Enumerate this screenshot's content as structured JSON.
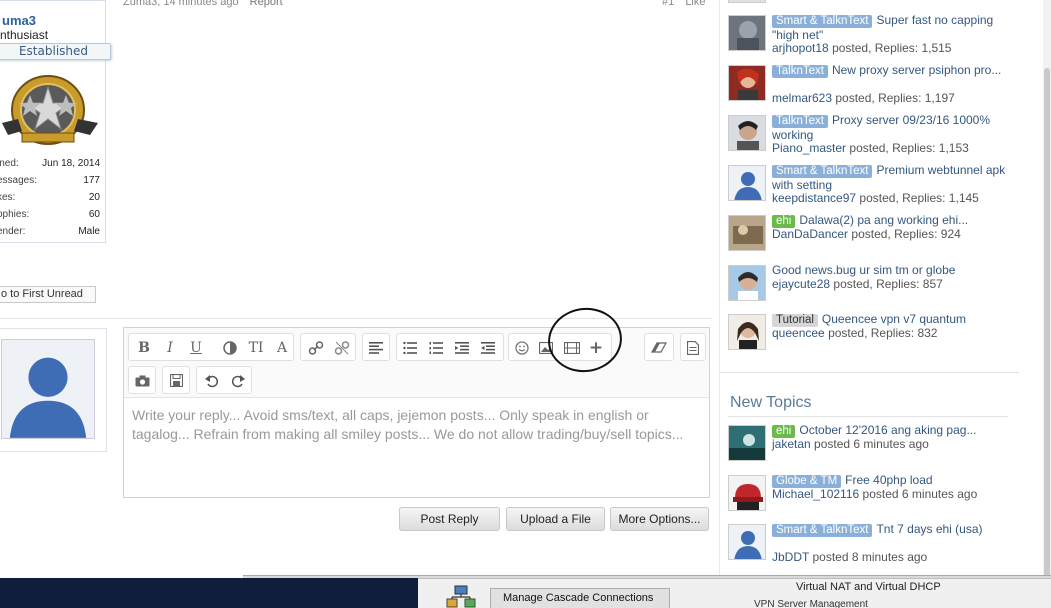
{
  "post": {
    "author": "Zuma3",
    "time": "Zuma3, 14 minutes ago",
    "report": "Report",
    "number": "#1",
    "like": "Like"
  },
  "user_card": {
    "name": "uma3",
    "title": "nthusiast",
    "banner": "Established",
    "stats": [
      {
        "key": "ined:",
        "value": "Jun 18, 2014"
      },
      {
        "key": "essages:",
        "value": "177"
      },
      {
        "key": "kes:",
        "value": "20"
      },
      {
        "key": "ophies:",
        "value": "60"
      },
      {
        "key": "ender:",
        "value": "Male"
      }
    ],
    "first_unread": "o to First Unread"
  },
  "editor": {
    "placeholder": "Write your reply... Avoid sms/text, all caps, jejemon posts... Only speak in english or tagalog... Refrain from making all smiley posts... We do not allow trading/buy/sell topics...",
    "toolbar": {
      "bold": "B",
      "italic": "I",
      "underline": "U",
      "text_size": "TI",
      "font": "A"
    }
  },
  "buttons": {
    "post_reply": "Post Reply",
    "upload_file": "Upload a File",
    "more_options": "More Options..."
  },
  "sidebar": {
    "threads": [
      {
        "prefix": "Smart & TalknText",
        "prefix_kind": "blue",
        "title": "Super fast no capping \"high net\"",
        "poster": "arjhopot18",
        "meta": "posted, Replies: 1,515"
      },
      {
        "prefix": "TalknText",
        "prefix_kind": "blue",
        "title": "New proxy server psiphon pro...",
        "poster": "melmar623",
        "meta": "posted, Replies: 1,197"
      },
      {
        "prefix": "TalknText",
        "prefix_kind": "blue",
        "title": "Proxy server 09/23/16 1000% working",
        "poster": "Piano_master",
        "meta": "posted, Replies: 1,153"
      },
      {
        "prefix": "Smart & TalknText",
        "prefix_kind": "blue",
        "title": "Premium webtunnel apk with setting",
        "poster": "keepdistance97",
        "meta": "posted, Replies: 1,145"
      },
      {
        "prefix": "ehi",
        "prefix_kind": "green",
        "title": "Dalawa(2) pa ang working ehi...",
        "poster": "DanDaDancer",
        "meta": "posted, Replies: 924"
      },
      {
        "prefix": "",
        "prefix_kind": "none",
        "title": "Good news.bug ur sim tm or globe",
        "poster": "ejaycute28",
        "meta": "posted, Replies: 857"
      },
      {
        "prefix": "Tutorial",
        "prefix_kind": "gray",
        "title": "Queencee vpn v7 quantum",
        "poster": "queencee",
        "meta": "posted, Replies: 832"
      }
    ],
    "new_topics_heading": "New Topics",
    "new_topics": [
      {
        "prefix": "ehi",
        "prefix_kind": "green",
        "title": "October 12'2016 ang aking pag...",
        "poster": "jaketan",
        "meta": "posted 6 minutes ago"
      },
      {
        "prefix": "Globe & TM",
        "prefix_kind": "blue",
        "title": "Free 40php load",
        "poster": "Michael_102116",
        "meta": "posted 6 minutes ago"
      },
      {
        "prefix": "Smart & TalknText",
        "prefix_kind": "blue",
        "title": "Tnt 7 days ehi (usa)",
        "poster": "JbDDT",
        "meta": "posted 8 minutes ago"
      }
    ]
  },
  "desktop": {
    "cascade_button": "Manage Cascade Connections",
    "nat_text": "Virtual NAT and Virtual DHCP",
    "vpn_text": "VPN Server Management"
  },
  "colors": {
    "link": "#34577f",
    "prefix_blue": "#8ab0da",
    "prefix_green": "#6bbb4a",
    "username": "#2b5f9e"
  }
}
